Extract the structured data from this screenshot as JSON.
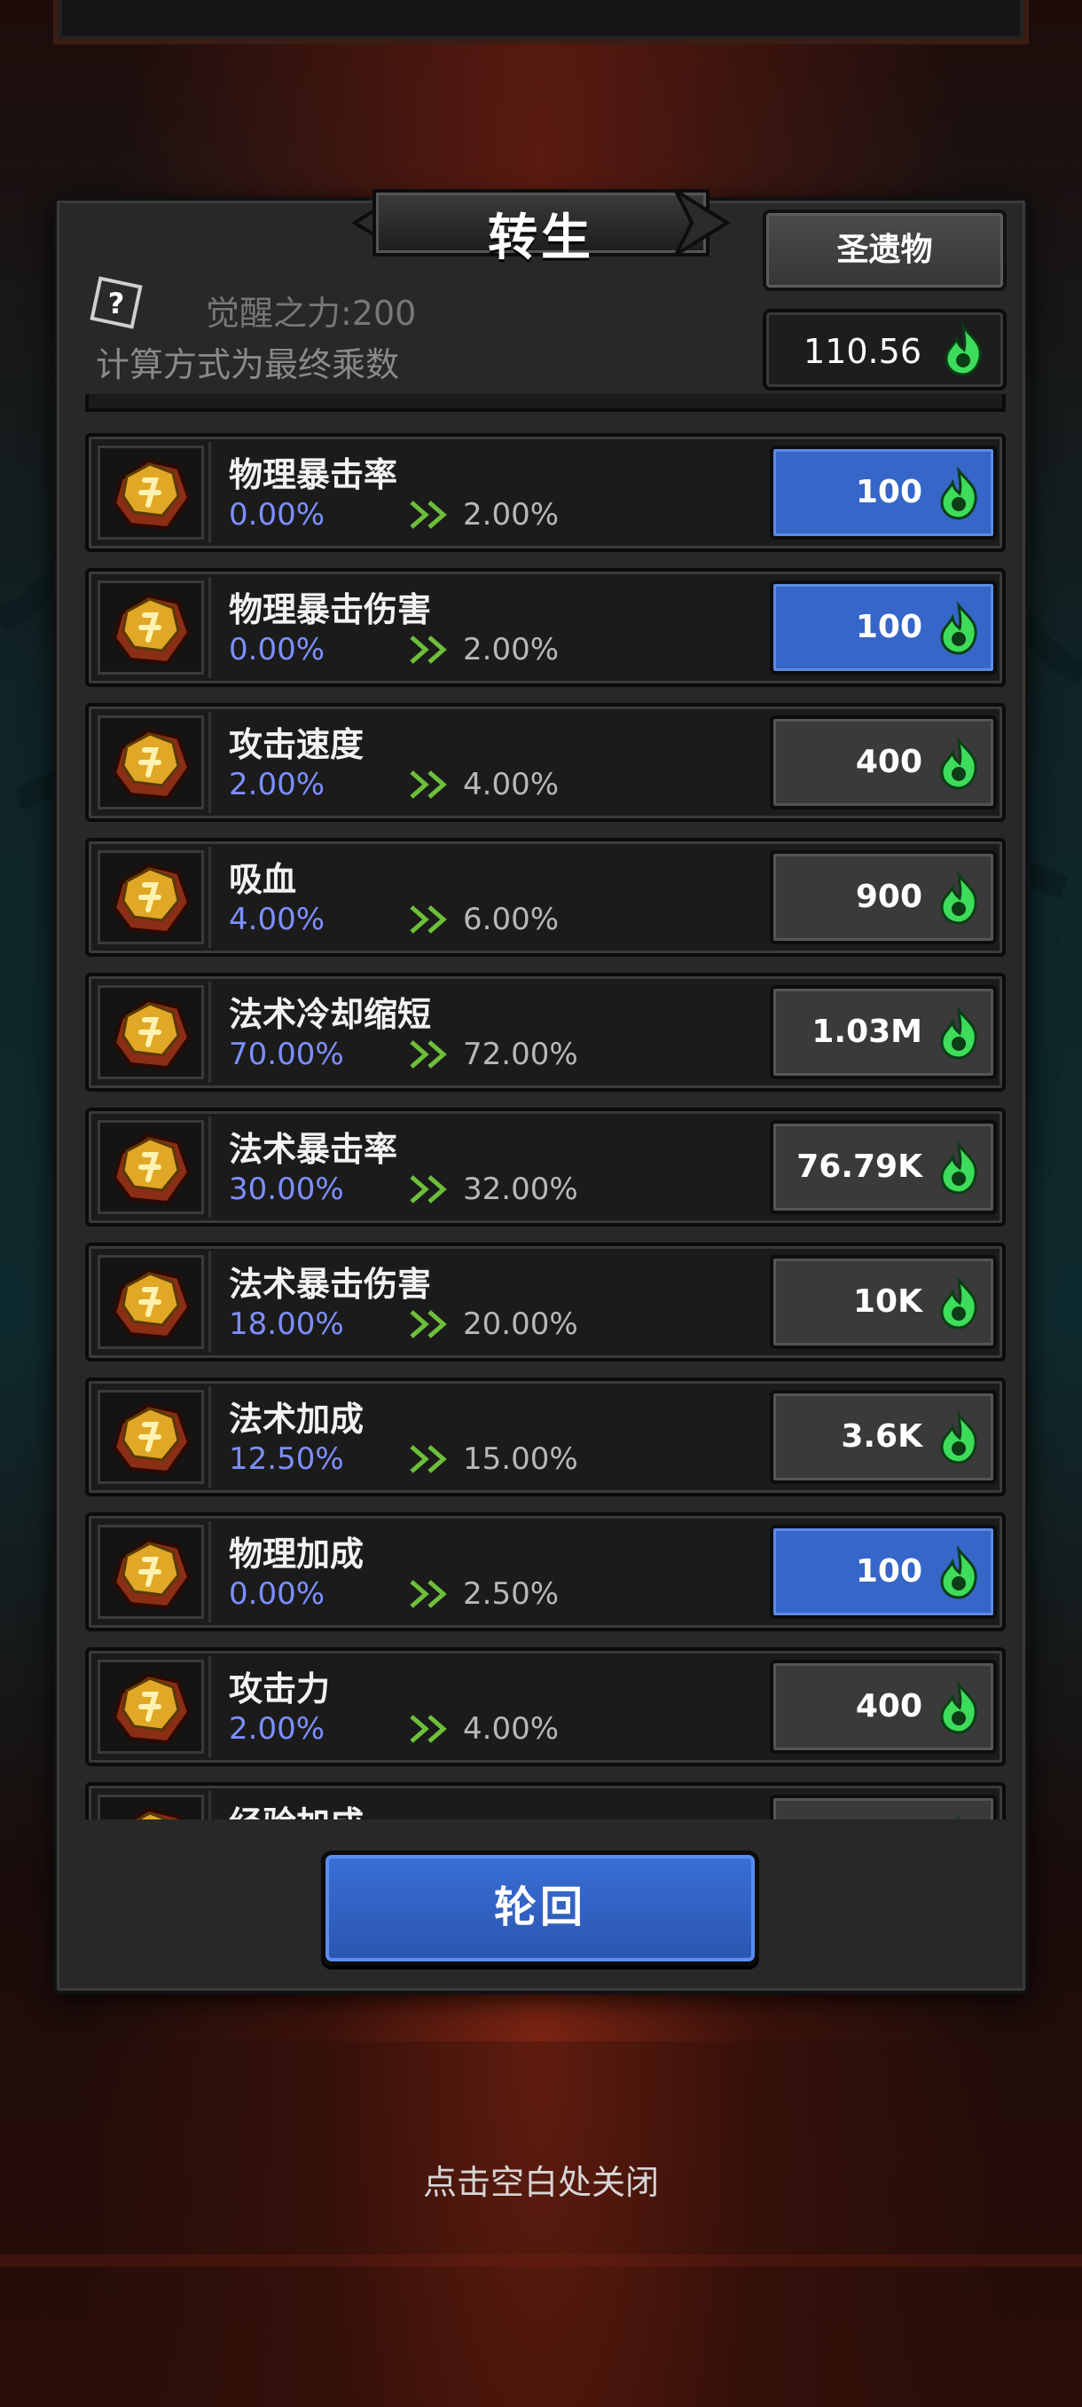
{
  "title": "转生",
  "relic_button": "圣遗物",
  "currency": {
    "value": "110.56",
    "icon": "green-flame-icon"
  },
  "info": {
    "awaken_power": "觉醒之力:200",
    "calc_note": "计算方式为最终乘数"
  },
  "stats": [
    {
      "name": "物理暴击率",
      "current": "0.00%",
      "next": "2.00%",
      "cost": "100",
      "affordable": true
    },
    {
      "name": "物理暴击伤害",
      "current": "0.00%",
      "next": "2.00%",
      "cost": "100",
      "affordable": true
    },
    {
      "name": "攻击速度",
      "current": "2.00%",
      "next": "4.00%",
      "cost": "400",
      "affordable": false
    },
    {
      "name": "吸血",
      "current": "4.00%",
      "next": "6.00%",
      "cost": "900",
      "affordable": false
    },
    {
      "name": "法术冷却缩短",
      "current": "70.00%",
      "next": "72.00%",
      "cost": "1.03M",
      "affordable": false
    },
    {
      "name": "法术暴击率",
      "current": "30.00%",
      "next": "32.00%",
      "cost": "76.79K",
      "affordable": false
    },
    {
      "name": "法术暴击伤害",
      "current": "18.00%",
      "next": "20.00%",
      "cost": "10K",
      "affordable": false
    },
    {
      "name": "法术加成",
      "current": "12.50%",
      "next": "15.00%",
      "cost": "3.6K",
      "affordable": false
    },
    {
      "name": "物理加成",
      "current": "0.00%",
      "next": "2.50%",
      "cost": "100",
      "affordable": true
    },
    {
      "name": "攻击力",
      "current": "2.00%",
      "next": "4.00%",
      "cost": "400",
      "affordable": false
    },
    {
      "name": "经验加成",
      "current": "",
      "next": "",
      "cost": "",
      "affordable": false
    }
  ],
  "rebirth_button": "轮回",
  "close_hint": "点击空白处关闭",
  "colors": {
    "affordable": "#3566c8",
    "current_value": "#7d8fff",
    "flame": "#3ddc5a"
  }
}
